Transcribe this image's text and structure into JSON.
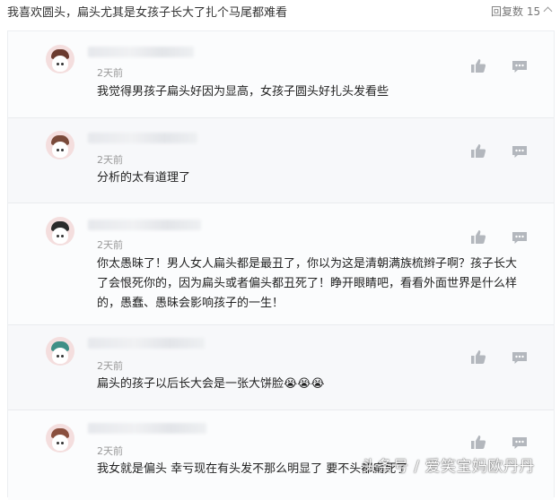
{
  "header": {
    "text": "我喜欢圆头，扁头尤其是女孩子长大了扎个马尾都难看",
    "reply_count": "回复数 15"
  },
  "comments": [
    {
      "time": "2天前",
      "text": "我觉得男孩子扁头好因为显高，女孩子圆头好扎头发看些",
      "avatar_hair": "#6b3a2e"
    },
    {
      "time": "2天前",
      "text": "分析的太有道理了",
      "avatar_hair": "#7a4a3a"
    },
    {
      "time": "2天前",
      "text": "你太愚昧了！男人女人扁头都是最丑了，你以为这是清朝满族梳辫子啊？孩子长大了会恨死你的，因为扁头或者偏头都丑死了！睁开眼睛吧，看看外面世界是什么样的，愚蠢、愚昧会影响孩子的一生！",
      "avatar_hair": "#2b2b2b"
    },
    {
      "time": "2天前",
      "text": "扁头的孩子以后长大会是一张大饼脸😭😭😭",
      "avatar_hair": "#3f8f86"
    },
    {
      "time": "2天前",
      "text": "我女就是偏头 幸亏现在有头发不那么明显了 要不头都扁死了",
      "avatar_hair": "#8a4f3e"
    }
  ],
  "icons": {
    "like": "thumbs-up-icon",
    "reply": "comment-bubble-icon"
  },
  "watermark": "头条号 / 爱笑宝妈欧丹丹"
}
